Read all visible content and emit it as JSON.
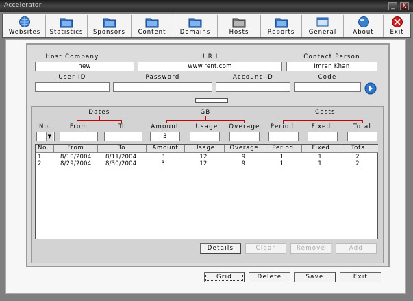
{
  "window": {
    "title": "Accelerator",
    "minimize": "_",
    "close": "X"
  },
  "toolbar": [
    {
      "label": "Websites",
      "icon": "globe-icon"
    },
    {
      "label": "Statistics",
      "icon": "folder-stats-icon"
    },
    {
      "label": "Sponsors",
      "icon": "folder-sponsors-icon"
    },
    {
      "label": "Content",
      "icon": "folder-content-icon"
    },
    {
      "label": "Domains",
      "icon": "folder-domains-icon"
    },
    {
      "label": "Hosts",
      "icon": "folder-hosts-icon"
    },
    {
      "label": "Reports",
      "icon": "folder-reports-icon"
    },
    {
      "label": "General",
      "icon": "window-icon"
    },
    {
      "label": "About",
      "icon": "globe-about-icon"
    },
    {
      "label": "Exit",
      "icon": "stop-icon"
    }
  ],
  "form": {
    "host_company_label": "Host Company",
    "host_company": "new",
    "url_label": "U.R.L",
    "url": "www.rent.com",
    "contact_label": "Contact Person",
    "contact": "Imran Khan",
    "user_id_label": "User ID",
    "user_id": "",
    "password_label": "Password",
    "password": "",
    "account_id_label": "Account ID",
    "account_id": "",
    "code_label": "Code",
    "code": ""
  },
  "filters": {
    "dates_group": "Dates",
    "gb_group": "GB",
    "costs_group": "Costs",
    "no_label": "No.",
    "from_label": "From",
    "to_label": "To",
    "amount_label": "Amount",
    "usage_label": "Usage",
    "overage_label": "Overage",
    "period_label": "Period",
    "fixed_label": "Fixed",
    "total_label": "Total",
    "amount_value": "3"
  },
  "table": {
    "columns": [
      "No.",
      "From",
      "To",
      "Amount",
      "Usage",
      "Overage",
      "Period",
      "Fixed",
      "Total"
    ],
    "rows": [
      [
        "1",
        "8/10/2004",
        "8/11/2004",
        "3",
        "12",
        "9",
        "1",
        "1",
        "2"
      ],
      [
        "2",
        "8/29/2004",
        "8/30/2004",
        "3",
        "12",
        "9",
        "1",
        "1",
        "2"
      ]
    ]
  },
  "grid_buttons": {
    "details": "Details",
    "clear": "Clear",
    "remove": "Remove",
    "add": "Add"
  },
  "footer_buttons": {
    "grid": "Grid",
    "delete": "Delete",
    "save": "Save",
    "exit": "Exit"
  },
  "colors": {
    "accent_red": "#cc0000",
    "panel": "#dcdcdc",
    "titlebar": "#2a2a2a"
  }
}
